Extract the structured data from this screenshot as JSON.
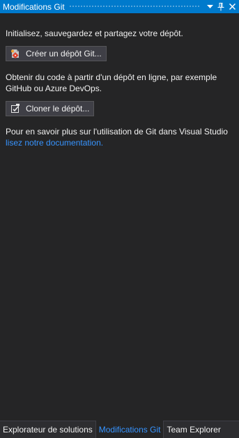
{
  "window": {
    "title": "Modifications Git"
  },
  "icons": {
    "dropdown": "dropdown-arrow-icon",
    "pin": "pin-icon",
    "close": "close-icon",
    "create_repo": "git-repo-icon",
    "clone": "clone-icon"
  },
  "content": {
    "intro_text": "Initialisez, sauvegardez et partagez votre dépôt.",
    "create_button_label": "Créer un dépôt Git...",
    "clone_text": "Obtenir du code à partir d'un dépôt en ligne, par exemple GitHub ou Azure DevOps.",
    "clone_button_label": "Cloner le dépôt...",
    "docs_text": "Pour en savoir plus sur l'utilisation de Git dans Visual Studio",
    "docs_link": "lisez notre documentation."
  },
  "tabs": [
    {
      "label": "Explorateur de solutions",
      "active": false
    },
    {
      "label": "Modifications Git",
      "active": true
    },
    {
      "label": "Team Explorer",
      "active": false
    }
  ],
  "colors": {
    "accent": "#007acc",
    "background": "#252526",
    "link": "#3794ff",
    "text": "#f1f1f1",
    "button_bg": "#3f3f46"
  }
}
